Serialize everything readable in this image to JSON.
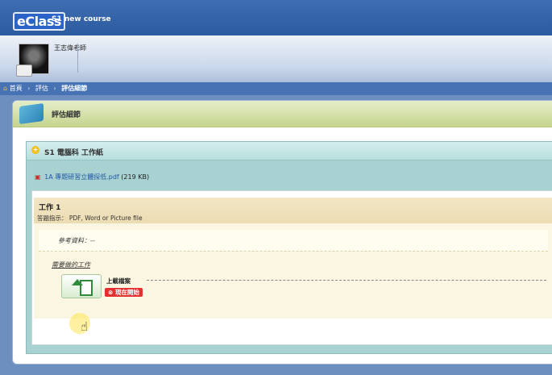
{
  "app": {
    "logo_text": "eClass",
    "course_title": "S1 new course"
  },
  "user": {
    "name": "王志偉老師"
  },
  "breadcrumb": {
    "home": "首頁",
    "sep": "›",
    "section": "評估",
    "current": "評估細節"
  },
  "panel": {
    "title": "評估細節"
  },
  "task": {
    "title": "S1 電腦科 工作紙",
    "attachment_label": "1A 專題研習立體探低.pdf",
    "attachment_size": "(219 KB)"
  },
  "work": {
    "title": "工作 1",
    "instructions": "答題指示： PDF, Word or Picture file",
    "reference": "參考資料：--",
    "todo_label": "需要做的工作",
    "upload_label": "上載檔案",
    "start_button": "現在開始"
  },
  "icons": {
    "home": "home-icon",
    "book": "book-icon",
    "task": "plus-circle-icon",
    "pdf": "pdf-icon",
    "upload": "upload-icon",
    "start": "start-icon",
    "cursor": "hand-pointer-icon"
  },
  "colors": {
    "topbar": "#3f6eb2",
    "breadcrumb": "#4772b4",
    "start_button": "#e53030",
    "task_box": "#a8d2d2",
    "work_head": "#f2e6c6"
  }
}
